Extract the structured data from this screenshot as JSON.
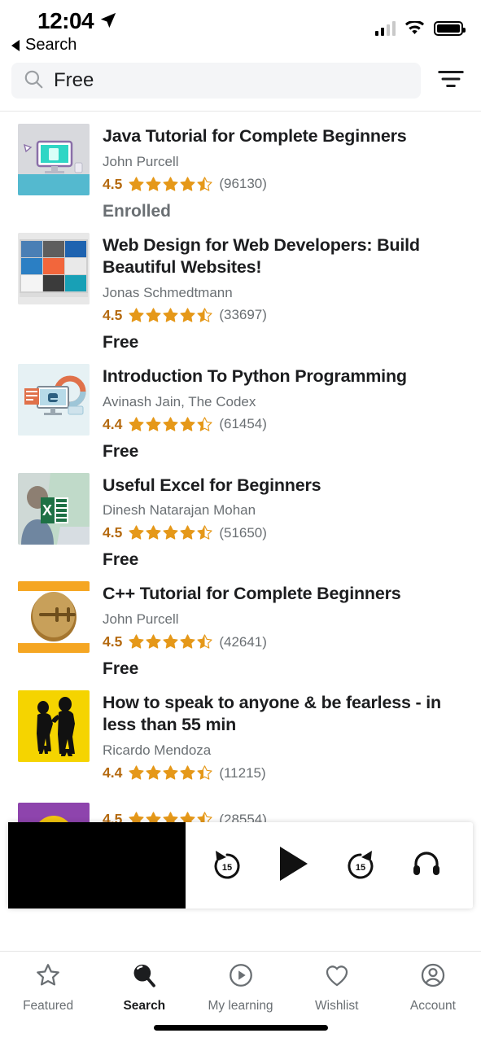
{
  "status_bar": {
    "time": "12:04",
    "location_icon": "location-arrow-icon",
    "signal_icon": "cellular-signal-icon",
    "signal_bars_filled": 2,
    "signal_bars_total": 4,
    "wifi_icon": "wifi-icon",
    "battery_icon": "battery-full-icon"
  },
  "back_link": {
    "label": "Search",
    "icon": "back-triangle-icon"
  },
  "search": {
    "icon": "search-icon",
    "value": "Free",
    "placeholder": "Search",
    "filter_icon": "filter-icon"
  },
  "courses": [
    {
      "title": "Java Tutorial for Complete Beginners",
      "author": "John Purcell",
      "rating": "4.5",
      "stars": 4.5,
      "reviews": "(96130)",
      "price": "Enrolled",
      "is_enrolled": true,
      "thumb": "java-desktop-thumbnail",
      "colors": {
        "bg": "#d8d9dd",
        "accent": "#2fd6c5",
        "desk": "#54b9cf"
      }
    },
    {
      "title": "Web Design for Web Developers: Build Beautiful Websites!",
      "author": "Jonas Schmedtmann",
      "rating": "4.5",
      "stars": 4.5,
      "reviews": "(33697)",
      "price": "Free",
      "is_enrolled": false,
      "thumb": "web-design-grid-thumbnail",
      "colors": {
        "bg": "#e8e8e8",
        "accent": "#f2663c",
        "desk": "#2f6fb5"
      }
    },
    {
      "title": "Introduction To Python Programming",
      "author": "Avinash Jain, The Codex",
      "rating": "4.4",
      "stars": 4.4,
      "reviews": "(61454)",
      "price": "Free",
      "is_enrolled": false,
      "thumb": "python-workstation-thumbnail",
      "colors": {
        "bg": "#e6f1f4",
        "accent": "#e0714a",
        "desk": "#3f6f8f"
      }
    },
    {
      "title": "Useful Excel for Beginners",
      "author": "Dinesh Natarajan Mohan",
      "rating": "4.5",
      "stars": 4.5,
      "reviews": "(51650)",
      "price": "Free",
      "is_enrolled": false,
      "thumb": "excel-logo-photo-thumbnail",
      "colors": {
        "bg": "#d6e4dc",
        "accent": "#1e7145",
        "desk": "#8ba9bd"
      }
    },
    {
      "title": "C++ Tutorial for Complete Beginners",
      "author": "John Purcell",
      "rating": "4.5",
      "stars": 4.5,
      "reviews": "(42641)",
      "price": "Free",
      "is_enrolled": false,
      "thumb": "cpp-coin-thumbnail",
      "colors": {
        "bg": "#ffffff",
        "accent": "#f5a623",
        "desk": "#a5762f"
      }
    },
    {
      "title": "How to speak to anyone & be fearless - in less than 55 min",
      "author": "Ricardo Mendoza",
      "rating": "4.4",
      "stars": 4.4,
      "reviews": "(11215)",
      "price": "",
      "is_enrolled": false,
      "thumb": "two-men-talking-yellow-thumbnail",
      "colors": {
        "bg": "#f5d400",
        "accent": "#111111",
        "desk": "#111111"
      }
    },
    {
      "title": "",
      "author": "",
      "rating": "4.5",
      "stars": 4.5,
      "reviews": "(28554)",
      "price": "",
      "is_enrolled": false,
      "thumb": "purple-gear-thumbnail",
      "colors": {
        "bg": "#8e44ad",
        "accent": "#f1c40f",
        "desk": "#ffffff"
      }
    }
  ],
  "player": {
    "video_thumbnail": "video-preview-black",
    "rewind_label": "15",
    "rewind_icon": "rewind-15-icon",
    "play_icon": "play-icon",
    "forward_label": "15",
    "forward_icon": "forward-15-icon",
    "headphones_icon": "headphones-icon"
  },
  "tabs": [
    {
      "label": "Featured",
      "icon": "star-icon",
      "active": false
    },
    {
      "label": "Search",
      "icon": "search-icon",
      "active": true
    },
    {
      "label": "My learning",
      "icon": "play-circle-icon",
      "active": false
    },
    {
      "label": "Wishlist",
      "icon": "heart-icon",
      "active": false
    },
    {
      "label": "Account",
      "icon": "account-circle-icon",
      "active": false
    }
  ],
  "colors": {
    "star": "#e59819",
    "rating_text": "#b4690e",
    "primary_text": "#1c1d1f",
    "secondary_text": "#6a6f73",
    "search_bg": "#f4f5f7"
  }
}
